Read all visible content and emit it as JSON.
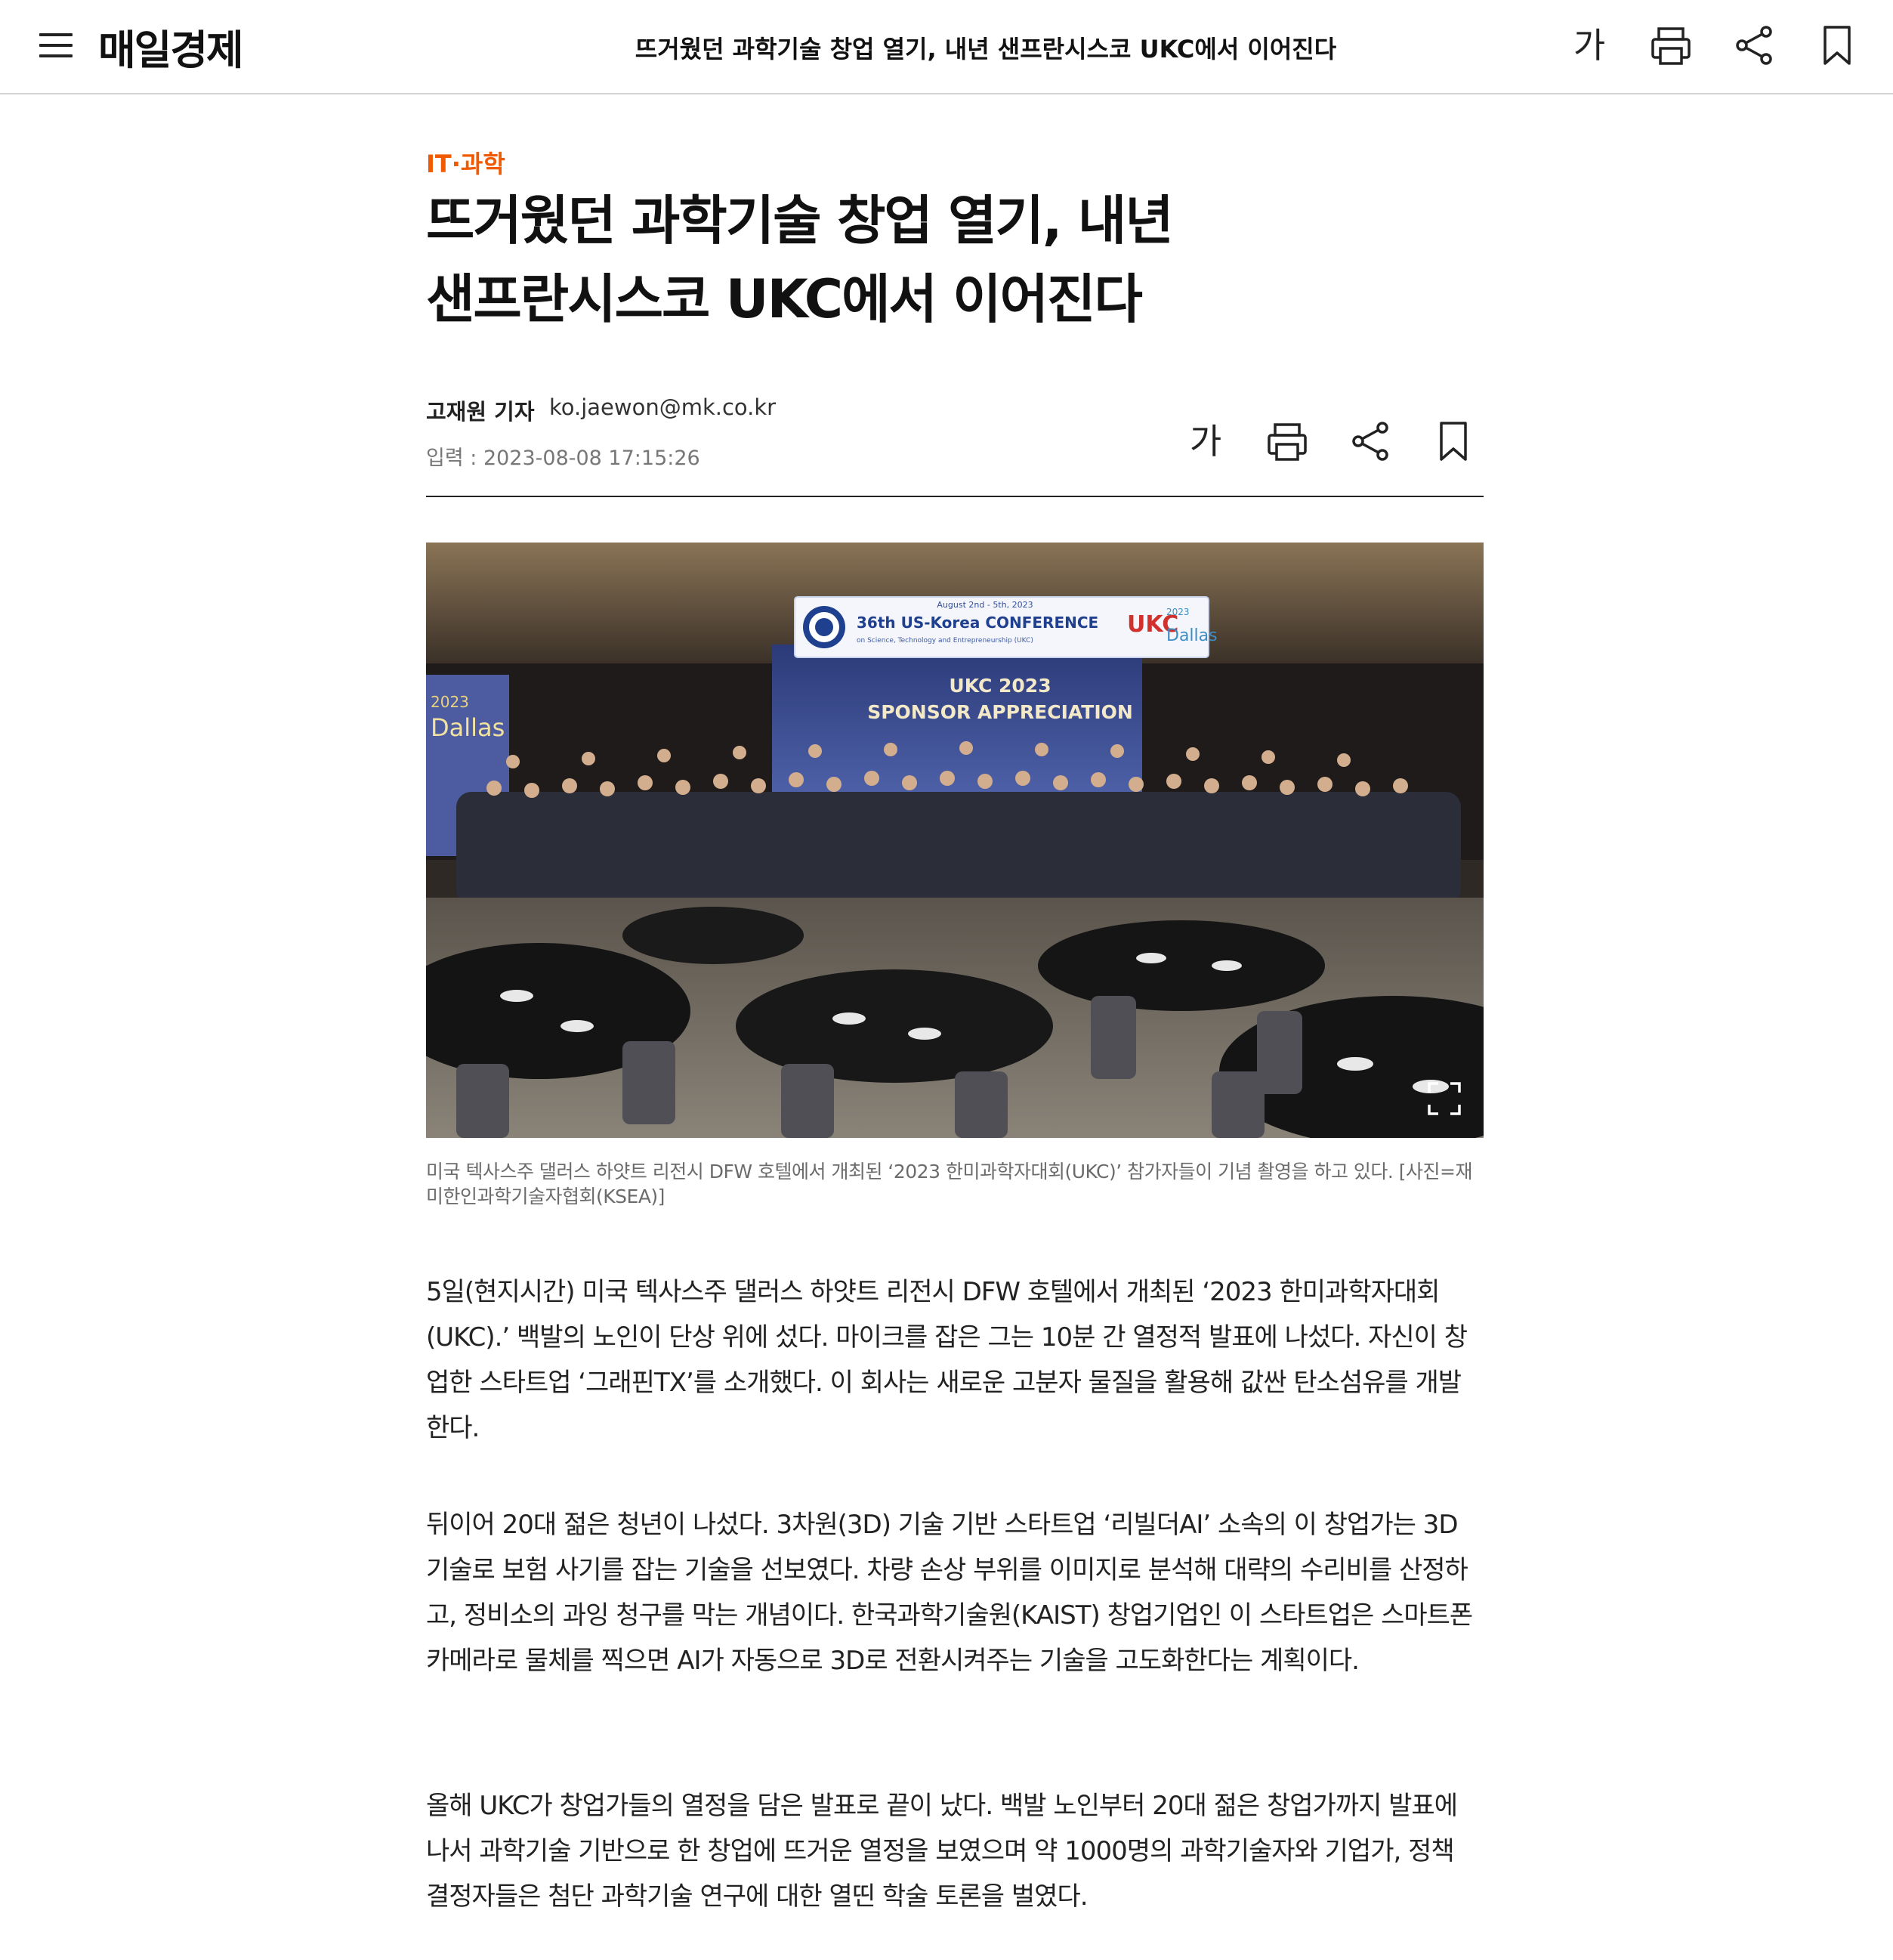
{
  "header": {
    "logo": "매일경제",
    "title": "뜨거웠던 과학기술 창업 열기, 내년 샌프란시스코 UKC에서 이어진다",
    "font_label": "가"
  },
  "article": {
    "category": "IT·과학",
    "headline_line1": "뜨거웠던 과학기술 창업 열기, 내년",
    "headline_line2": "샌프란시스코 UKC에서 이어진다",
    "author": "고재원 기자",
    "email": "ko.jaewon@mk.co.kr",
    "date": "입력 : 2023-08-08 17:15:26",
    "font_label": "가",
    "photo": {
      "banner_date": "August 2nd - 5th, 2023",
      "banner_title": "36th US-Korea CONFERENCE",
      "banner_sub": "on Science, Technology and Entrepreneurship (UKC)",
      "banner_logo": "UKC",
      "banner_year": "2023",
      "banner_city": "Dallas",
      "screen_line1": "UKC 2023",
      "screen_line2": "SPONSOR APPRECIATION",
      "side_year": "2023",
      "side_city": "Dallas"
    },
    "caption": "미국 텍사스주 댈러스 하얏트 리전시 DFW 호텔에서 개최된 ‘2023 한미과학자대회(UKC)’ 참가자들이 기념 촬영을 하고 있다. [사진=재미한인과학기술자협회(KSEA)]",
    "paragraphs": [
      "5일(현지시간) 미국 텍사스주 댈러스 하얏트 리전시 DFW 호텔에서 개최된 ‘2023 한미과학자대회(UKC).’ 백발의 노인이 단상 위에 섰다. 마이크를 잡은 그는 10분 간 열정적 발표에 나섰다. 자신이 창업한 스타트업 ‘그래핀TX’를 소개했다. 이 회사는 새로운 고분자 물질을 활용해 값싼 탄소섬유를 개발한다.",
      "뒤이어 20대 젊은 청년이 나섰다. 3차원(3D) 기술 기반 스타트업 ‘리빌더AI’ 소속의 이 창업가는 3D 기술로 보험 사기를 잡는 기술을 선보였다. 차량 손상 부위를 이미지로 분석해 대략의 수리비를 산정하고, 정비소의 과잉 청구를 막는 개념이다. 한국과학기술원(KAIST) 창업기업인 이 스타트업은 스마트폰 카메라로 물체를 찍으면 AI가 자동으로 3D로 전환시켜주는 기술을 고도화한다는 계획이다.",
      "올해 UKC가 창업가들의 열정을 담은 발표로 끝이 났다. 백발 노인부터 20대 젊은 창업가까지 발표에 나서 과학기술 기반으로 한 창업에 뜨거운 열정을 보였으며 약 1000명의 과학기술자와 기업가, 정책 결정자들은 첨단 과학기술 연구에 대한 열띤 학술 토론을 벌였다."
    ]
  },
  "colors": {
    "accent": "#f05a00",
    "text": "#222222",
    "muted": "#777777"
  },
  "icons": [
    "menu-icon",
    "font-size-icon",
    "print-icon",
    "share-icon",
    "bookmark-icon",
    "expand-icon"
  ]
}
